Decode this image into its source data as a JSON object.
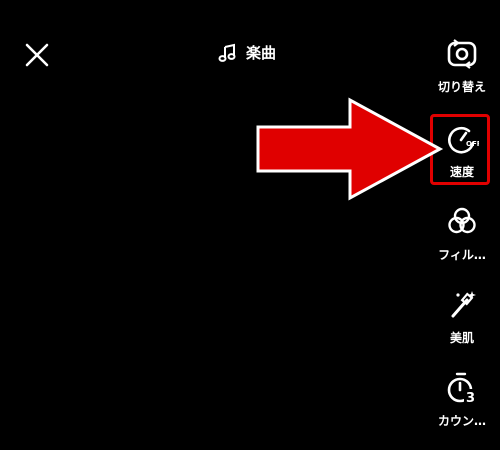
{
  "top_bar": {
    "music_label": "楽曲"
  },
  "tools": [
    {
      "label": "切り替え",
      "icon": "camera-flip-icon"
    },
    {
      "label": "速度",
      "icon": "speed-off-icon",
      "badge": "OFF"
    },
    {
      "label": "フィル…",
      "icon": "filter-icon"
    },
    {
      "label": "美肌",
      "icon": "magic-wand-icon"
    },
    {
      "label": "カウン…",
      "icon": "timer-3-icon",
      "badge": "3"
    }
  ],
  "annotation": {
    "arrow_color": "#e00000",
    "highlight_color": "#e00000"
  }
}
